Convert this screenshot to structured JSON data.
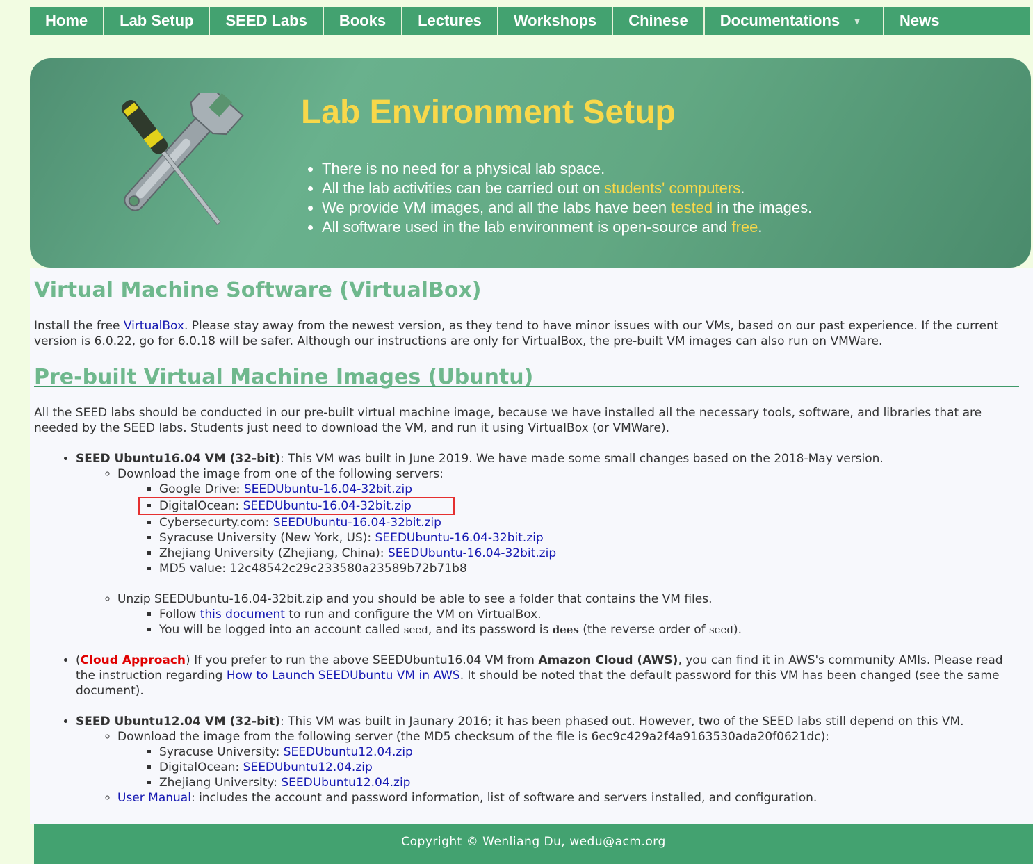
{
  "nav": {
    "items": [
      "Home",
      "Lab Setup",
      "SEED Labs",
      "Books",
      "Lectures",
      "Workshops",
      "Chinese",
      "Documentations",
      "News"
    ]
  },
  "banner": {
    "title": "Lab Environment Setup",
    "bullets": [
      {
        "pre": "There is no need for a physical lab space.",
        "hl": "",
        "post": ""
      },
      {
        "pre": "All the lab activities can be carried out on ",
        "hl": "students' computers",
        "post": "."
      },
      {
        "pre": "We provide VM images, and all the labs have been ",
        "hl": "tested",
        "post": " in the images."
      },
      {
        "pre": "All software used in the lab environment is open-source and ",
        "hl": "free",
        "post": "."
      }
    ],
    "colors": {
      "title": "#f8d84a",
      "highlight": "#f8d84a"
    }
  },
  "vbox": {
    "heading": "Virtual Machine Software (VirtualBox)",
    "pre": "Install the free ",
    "link": "VirtualBox",
    "post": ". Please stay away from the newest version, as they tend to have minor issues with our VMs, based on our past experience. If the current version is 6.0.22, go for 6.0.18 will be safer. Although our instructions are only for VirtualBox, the pre-built VM images can also run on VMWare."
  },
  "prebuilt": {
    "heading": "Pre-built Virtual Machine Images (Ubuntu)",
    "intro": "All the SEED labs should be conducted in our pre-built virtual machine image, because we have installed all the necessary tools, software, and libraries that are needed by the SEED labs. Students just need to download the VM, and run it using VirtualBox (or VMWare)."
  },
  "u16": {
    "title": "SEED Ubuntu16.04 VM (32-bit)",
    "desc": ": This VM was built in June 2019. We have made some small changes based on the 2018-May version.",
    "download_intro": "Download the image from one of the following servers:",
    "servers": [
      {
        "name": "Google Drive: ",
        "file": "SEEDUbuntu-16.04-32bit.zip"
      },
      {
        "name": "DigitalOcean: ",
        "file": "SEEDUbuntu-16.04-32bit.zip"
      },
      {
        "name": "Cybersecurty.com: ",
        "file": "SEEDUbuntu-16.04-32bit.zip"
      },
      {
        "name": "Syracuse University (New York, US): ",
        "file": "SEEDUbuntu-16.04-32bit.zip"
      },
      {
        "name": "Zhejiang University (Zhejiang, China): ",
        "file": "SEEDUbuntu-16.04-32bit.zip"
      }
    ],
    "md5": "MD5 value: 12c48542c29c233580a23589b72b71b8",
    "unzip": "Unzip SEEDUbuntu-16.04-32bit.zip and you should be able to see a folder that contains the VM files.",
    "follow_pre": "Follow ",
    "follow_link": "this document",
    "follow_post": " to run and configure the VM on VirtualBox.",
    "login_pre": "You will be logged into an account called ",
    "login_user": "seed",
    "login_mid": ", and its password is ",
    "login_pass": "dees",
    "login_mid2": " (the reverse order of ",
    "login_user2": "seed",
    "login_post": ")."
  },
  "cloud": {
    "open": "(",
    "label": "Cloud Approach",
    "text1": ") If you prefer to run the above SEEDUbuntu16.04 VM from ",
    "aws": "Amazon Cloud (AWS)",
    "text2": ", you can find it in AWS's community AMIs. Please read the instruction regarding ",
    "link": "How to Launch SEEDUbuntu VM in AWS",
    "text3": ". It should be noted that the default password for this VM has been changed (see the same document)."
  },
  "u12": {
    "title": "SEED Ubuntu12.04 VM (32-bit)",
    "desc": ": This VM was built in Jaunary 2016; it has been phased out. However, two of the SEED labs still depend on this VM.",
    "download_intro": "Download the image from the following server (the MD5 checksum of the file is 6ec9c429a2f4a9163530ada20f0621dc):",
    "servers": [
      {
        "name": "Syracuse University: ",
        "file": "SEEDUbuntu12.04.zip"
      },
      {
        "name": "DigitalOcean: ",
        "file": "SEEDUbuntu12.04.zip"
      },
      {
        "name": "Zhejiang University: ",
        "file": "SEEDUbuntu12.04.zip"
      }
    ],
    "manual_link": "User Manual",
    "manual_post": ": includes the account and password information, list of software and servers installed, and configuration."
  },
  "footer": {
    "text": "Copyright © Wenliang Du, wedu@acm.org"
  }
}
